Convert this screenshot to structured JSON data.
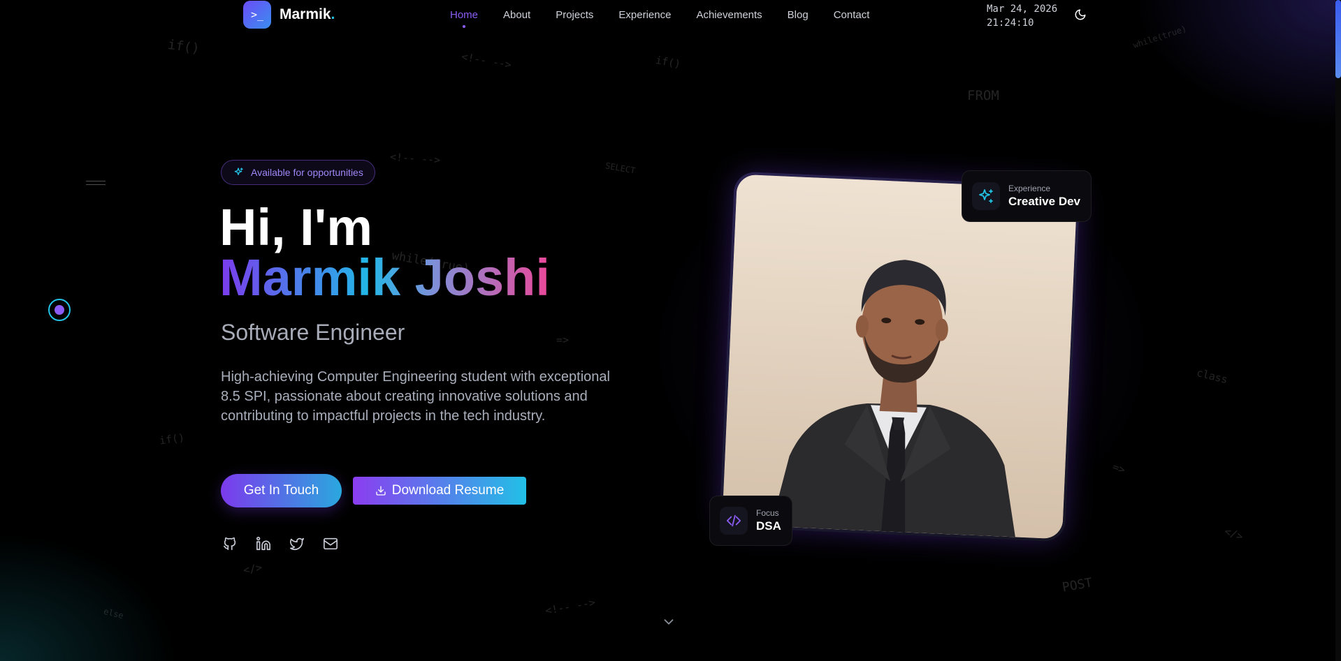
{
  "nav": {
    "brand": "Marmik",
    "brand_dot": ".",
    "logo_glyph": ">_",
    "items": [
      {
        "label": "Home",
        "active": true
      },
      {
        "label": "About",
        "active": false
      },
      {
        "label": "Projects",
        "active": false
      },
      {
        "label": "Experience",
        "active": false
      },
      {
        "label": "Achievements",
        "active": false
      },
      {
        "label": "Blog",
        "active": false
      },
      {
        "label": "Contact",
        "active": false
      }
    ],
    "date": "Mar 24, 2026",
    "time": "21:24:10",
    "theme_icon": "moon-icon"
  },
  "hero": {
    "badge": "Available for opportunities",
    "greeting": "Hi, I'm",
    "name": "Marmik Joshi",
    "role": "Software Engineer",
    "description": "High-achieving Computer Engineering student with exceptional 8.5 SPI, passionate about creating innovative solutions and contributing to impactful projects in the tech industry.",
    "primary_button": "Get In Touch",
    "secondary_button": "Download Resume",
    "socials": [
      "github-icon",
      "linkedin-icon",
      "twitter-icon",
      "mail-icon"
    ]
  },
  "cards": {
    "experience": {
      "label": "Experience",
      "value": "Creative Dev"
    },
    "focus": {
      "label": "Focus",
      "value": "DSA"
    }
  },
  "background_code": [
    "if()",
    "<!-- -->",
    "if()",
    "while(true)",
    "FROM",
    "<!-- -->",
    "SELECT",
    "while(true)",
    "=>",
    "class",
    "if()",
    "</>",
    "else",
    "<!-- -->",
    "POST",
    "=>",
    "</>"
  ],
  "colors": {
    "accent_purple": "#8b5cf6",
    "accent_cyan": "#22c3e6",
    "accent_pink": "#ec4899",
    "background": "#000000"
  }
}
